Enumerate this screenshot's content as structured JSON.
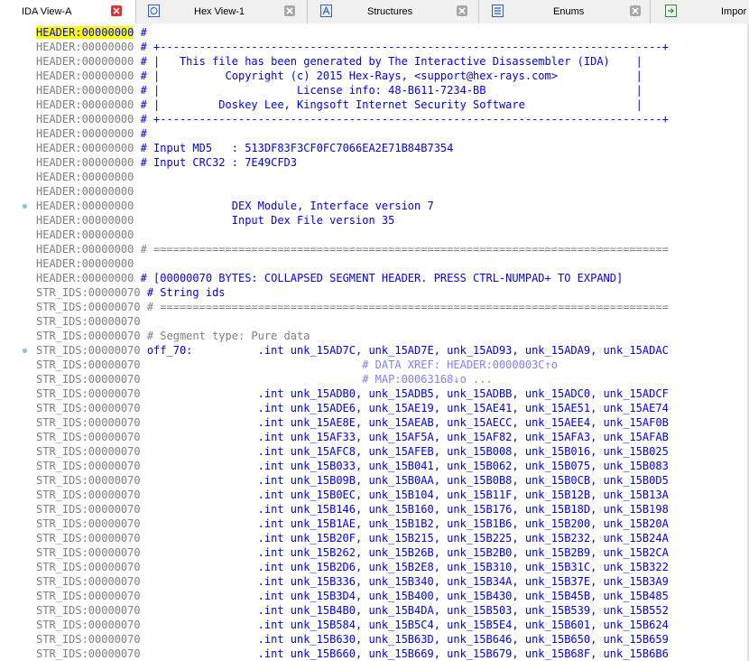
{
  "tabs": [
    {
      "label": "IDA View-A",
      "icon": "none",
      "active": true
    },
    {
      "label": "Hex View-1",
      "icon": "hex-view-icon",
      "active": false
    },
    {
      "label": "Structures",
      "icon": "structures-icon",
      "active": false
    },
    {
      "label": "Enums",
      "icon": "enums-icon",
      "active": false
    },
    {
      "label": "Impor",
      "icon": "imports-icon",
      "active": false
    }
  ],
  "colors": {
    "code_blue": "#0000ff",
    "address_gray": "#808080",
    "xref_purple": "#8080ff",
    "current_line_highlight": "#ffff00",
    "close_button_red": "#e0302a",
    "breakpoint_dot": "#7fc3e6"
  },
  "listing": [
    {
      "addr": "HEADER:00000000",
      "text": " #",
      "cls": "code",
      "current": true
    },
    {
      "addr": "HEADER:00000000",
      "text": " # +-----------------------------------------------------------------------------+",
      "cls": "code"
    },
    {
      "addr": "HEADER:00000000",
      "text": " # |   This file has been generated by The Interactive Disassembler (IDA)    |",
      "cls": "code"
    },
    {
      "addr": "HEADER:00000000",
      "text": " # |          Copyright (c) 2015 Hex-Rays, <support@hex-rays.com>            |",
      "cls": "code"
    },
    {
      "addr": "HEADER:00000000",
      "text": " # |                     License info: 48-B611-7234-BB                       |",
      "cls": "code"
    },
    {
      "addr": "HEADER:00000000",
      "text": " # |         Doskey Lee, Kingsoft Internet Security Software                 |",
      "cls": "code"
    },
    {
      "addr": "HEADER:00000000",
      "text": " # +-----------------------------------------------------------------------------+",
      "cls": "code"
    },
    {
      "addr": "HEADER:00000000",
      "text": " #",
      "cls": "code"
    },
    {
      "addr": "HEADER:00000000",
      "text": " # Input MD5   : 513DF83F3CF0FC7066EA2E71B84B7354",
      "cls": "code"
    },
    {
      "addr": "HEADER:00000000",
      "text": " # Input CRC32 : 7E49CFD3",
      "cls": "code"
    },
    {
      "addr": "HEADER:00000000",
      "text": "",
      "cls": "code"
    },
    {
      "addr": "HEADER:00000000",
      "text": "",
      "cls": "code"
    },
    {
      "addr": "HEADER:00000000",
      "text": "               DEX Module, Interface version 7",
      "cls": "code",
      "dot": true
    },
    {
      "addr": "HEADER:00000000",
      "text": "               Input Dex File version 35",
      "cls": "code"
    },
    {
      "addr": "HEADER:00000000",
      "text": "",
      "cls": "code"
    },
    {
      "addr": "HEADER:00000000",
      "text": " # ===============================================================================",
      "cls": "cmt"
    },
    {
      "addr": "HEADER:00000000",
      "text": "",
      "cls": "code"
    },
    {
      "addr": "HEADER:00000000",
      "text": " # [00000070 BYTES: COLLAPSED SEGMENT HEADER. PRESS CTRL-NUMPAD+ TO EXPAND]",
      "cls": "code"
    },
    {
      "addr": "STR_IDS:00000070",
      "text": " # String ids",
      "cls": "code"
    },
    {
      "addr": "STR_IDS:00000070",
      "text": " # ==============================================================================",
      "cls": "cmt"
    },
    {
      "addr": "STR_IDS:00000070",
      "text": "",
      "cls": "code"
    },
    {
      "addr": "STR_IDS:00000070",
      "text": " # Segment type: Pure data",
      "cls": "cmt"
    },
    {
      "addr": "STR_IDS:00000070",
      "text": " off_70:          .int unk_15AD7C, unk_15AD7E, unk_15AD93, unk_15ADA9, unk_15ADAC",
      "cls": "code",
      "dot": true
    },
    {
      "addr": "STR_IDS:00000070",
      "text": "                                  # DATA XREF: HEADER:0000003C↑o",
      "cls": "xref"
    },
    {
      "addr": "STR_IDS:00000070",
      "text": "                                  # MAP:00063168↓o ...",
      "cls": "xref"
    },
    {
      "addr": "STR_IDS:00000070",
      "text": "                  .int unk_15ADB0, unk_15ADB5, unk_15ADBB, unk_15ADC0, unk_15ADCF",
      "cls": "code"
    },
    {
      "addr": "STR_IDS:00000070",
      "text": "                  .int unk_15ADE6, unk_15AE19, unk_15AE41, unk_15AE51, unk_15AE74",
      "cls": "code"
    },
    {
      "addr": "STR_IDS:00000070",
      "text": "                  .int unk_15AE8E, unk_15AEAB, unk_15AECC, unk_15AEE4, unk_15AF0B",
      "cls": "code"
    },
    {
      "addr": "STR_IDS:00000070",
      "text": "                  .int unk_15AF33, unk_15AF5A, unk_15AF82, unk_15AFA3, unk_15AFAB",
      "cls": "code"
    },
    {
      "addr": "STR_IDS:00000070",
      "text": "                  .int unk_15AFC8, unk_15AFEB, unk_15B008, unk_15B016, unk_15B025",
      "cls": "code"
    },
    {
      "addr": "STR_IDS:00000070",
      "text": "                  .int unk_15B033, unk_15B041, unk_15B062, unk_15B075, unk_15B083",
      "cls": "code"
    },
    {
      "addr": "STR_IDS:00000070",
      "text": "                  .int unk_15B09B, unk_15B0AA, unk_15B0B8, unk_15B0CB, unk_15B0D5",
      "cls": "code"
    },
    {
      "addr": "STR_IDS:00000070",
      "text": "                  .int unk_15B0EC, unk_15B104, unk_15B11F, unk_15B12B, unk_15B13A",
      "cls": "code"
    },
    {
      "addr": "STR_IDS:00000070",
      "text": "                  .int unk_15B146, unk_15B160, unk_15B176, unk_15B18D, unk_15B198",
      "cls": "code"
    },
    {
      "addr": "STR_IDS:00000070",
      "text": "                  .int unk_15B1AE, unk_15B1B2, unk_15B1B6, unk_15B200, unk_15B20A",
      "cls": "code"
    },
    {
      "addr": "STR_IDS:00000070",
      "text": "                  .int unk_15B20F, unk_15B215, unk_15B225, unk_15B232, unk_15B24A",
      "cls": "code"
    },
    {
      "addr": "STR_IDS:00000070",
      "text": "                  .int unk_15B262, unk_15B26B, unk_15B2B0, unk_15B2B9, unk_15B2CA",
      "cls": "code"
    },
    {
      "addr": "STR_IDS:00000070",
      "text": "                  .int unk_15B2D6, unk_15B2E8, unk_15B310, unk_15B31C, unk_15B322",
      "cls": "code"
    },
    {
      "addr": "STR_IDS:00000070",
      "text": "                  .int unk_15B336, unk_15B340, unk_15B34A, unk_15B37E, unk_15B3A9",
      "cls": "code"
    },
    {
      "addr": "STR_IDS:00000070",
      "text": "                  .int unk_15B3D4, unk_15B400, unk_15B430, unk_15B45B, unk_15B485",
      "cls": "code"
    },
    {
      "addr": "STR_IDS:00000070",
      "text": "                  .int unk_15B4B0, unk_15B4DA, unk_15B503, unk_15B539, unk_15B552",
      "cls": "code"
    },
    {
      "addr": "STR_IDS:00000070",
      "text": "                  .int unk_15B584, unk_15B5C4, unk_15B5E4, unk_15B601, unk_15B624",
      "cls": "code"
    },
    {
      "addr": "STR_IDS:00000070",
      "text": "                  .int unk_15B630, unk_15B63D, unk_15B646, unk_15B650, unk_15B659",
      "cls": "code"
    },
    {
      "addr": "STR_IDS:00000070",
      "text": "                  .int unk_15B660, unk_15B669, unk_15B679, unk_15B68F, unk_15B6B6",
      "cls": "code"
    }
  ]
}
